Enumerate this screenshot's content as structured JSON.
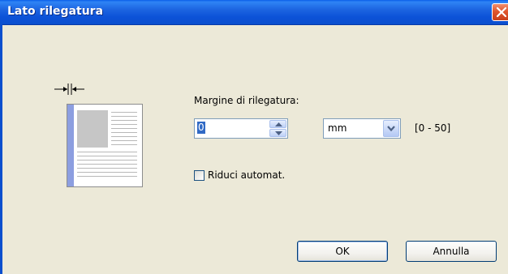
{
  "window": {
    "title": "Lato rilegatura"
  },
  "form": {
    "margin_label": "Margine di rilegatura:",
    "margin_value": "0",
    "unit_value": "mm",
    "range_text": "[0 - 50]",
    "auto_reduce_label": "Riduci automat.",
    "auto_reduce_checked": false
  },
  "buttons": {
    "ok": "OK",
    "cancel": "Annulla"
  },
  "icons": {
    "close": "close-icon",
    "binding_margin": "binding-margin-arrows-icon",
    "page_preview": "page-preview-icon",
    "spin_up": "triangle-up-icon",
    "spin_down": "triangle-down-icon",
    "dropdown": "chevron-down-icon"
  },
  "colors": {
    "titlebar": "#0b4fce",
    "close_button": "#e0562e",
    "dialog_bg": "#ece9d8",
    "binding_edge": "#8c9ee0",
    "selection": "#316ac5"
  }
}
